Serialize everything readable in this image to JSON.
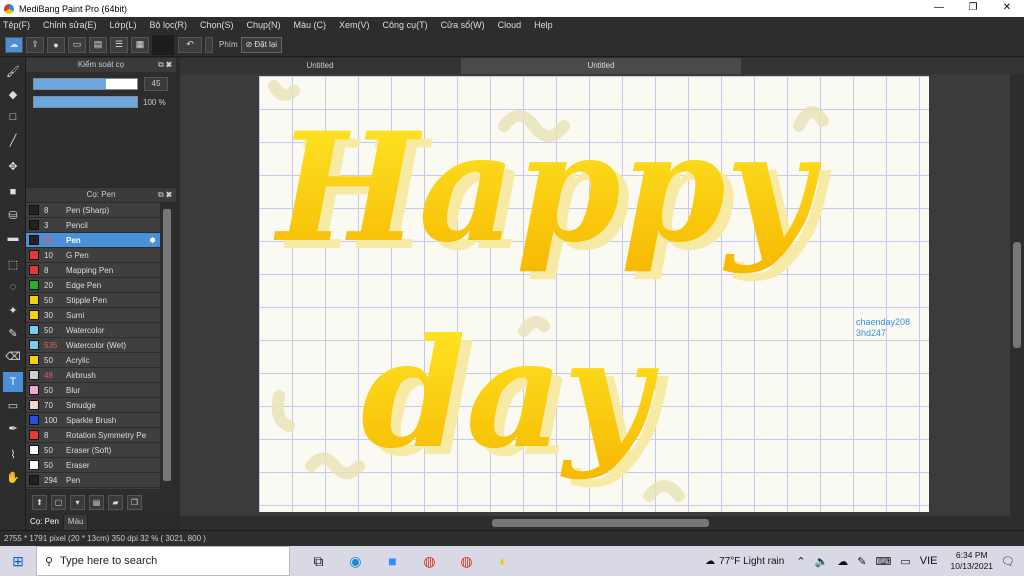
{
  "window": {
    "title": "MediBang Paint Pro (64bit)",
    "minimize_icon": "minimize-icon",
    "maximize_icon": "restore-icon",
    "close_icon": "close-icon"
  },
  "menu": [
    "Tệp(F)",
    "Chỉnh sửa(E)",
    "Lớp(L)",
    "Bộ lọc(R)",
    "Chọn(S)",
    "Chụp(N)",
    "Màu (C)",
    "Xem(V)",
    "Công cụ(T)",
    "Cửa sổ(W)",
    "Cloud",
    "Help"
  ],
  "toolbar": {
    "key_label": "Phím",
    "reset_label": "Đặt lại"
  },
  "brush_control": {
    "title": "Kiểm soát cọ",
    "size_value": "45",
    "size_fill": 0.7,
    "opacity_value": "100 %",
    "opacity_fill": 1.0
  },
  "brush_panel": {
    "title": "Cọ: Pen",
    "items": [
      {
        "size": "8",
        "name": "Pen (Sharp)",
        "color": "#222222",
        "red": false,
        "selected": false
      },
      {
        "size": "3",
        "name": "Pencil",
        "color": "#222222",
        "red": false,
        "selected": false
      },
      {
        "size": "45",
        "name": "Pen",
        "color": "#222222",
        "red": true,
        "selected": true
      },
      {
        "size": "10",
        "name": "G Pen",
        "color": "#e53935",
        "red": false,
        "selected": false
      },
      {
        "size": "8",
        "name": "Mapping Pen",
        "color": "#e53935",
        "red": false,
        "selected": false
      },
      {
        "size": "20",
        "name": "Edge Pen",
        "color": "#2fa82f",
        "red": false,
        "selected": false
      },
      {
        "size": "50",
        "name": "Stipple Pen",
        "color": "#f5d400",
        "red": false,
        "selected": false
      },
      {
        "size": "30",
        "name": "Sumi",
        "color": "#f5d400",
        "red": false,
        "selected": false
      },
      {
        "size": "50",
        "name": "Watercolor",
        "color": "#7ecbf0",
        "red": false,
        "selected": false
      },
      {
        "size": "535",
        "name": "Watercolor (Wet)",
        "color": "#7ecbf0",
        "red": true,
        "selected": false
      },
      {
        "size": "50",
        "name": "Acrylic",
        "color": "#f5d400",
        "red": false,
        "selected": false
      },
      {
        "size": "48",
        "name": "Airbrush",
        "color": "#cfcfcf",
        "red": true,
        "selected": false
      },
      {
        "size": "50",
        "name": "Blur",
        "color": "#f4a6d8",
        "red": false,
        "selected": false
      },
      {
        "size": "70",
        "name": "Smudge",
        "color": "#f2d9c8",
        "red": false,
        "selected": false
      },
      {
        "size": "100",
        "name": "Sparkle Brush",
        "color": "#2a4fd6",
        "red": false,
        "selected": false
      },
      {
        "size": "8",
        "name": "Rotation Symmetry Pe",
        "color": "#e53935",
        "red": false,
        "selected": false
      },
      {
        "size": "50",
        "name": "Eraser (Soft)",
        "color": "#ffffff",
        "red": false,
        "selected": false
      },
      {
        "size": "50",
        "name": "Eraser",
        "color": "#ffffff",
        "red": false,
        "selected": false
      },
      {
        "size": "294",
        "name": "Pen",
        "color": "#222222",
        "red": false,
        "selected": false
      }
    ]
  },
  "panel_tabs": [
    "Cọ: Pen",
    "Màu"
  ],
  "document_tabs": [
    "Untitled",
    "Untitled"
  ],
  "canvas": {
    "watermark_line1": "chaenday208",
    "watermark_line2": "3hd247"
  },
  "status": "2755 * 1791 pixel  (20 * 13cm)  350 dpi  32 %  ( 3021, 800 )",
  "taskbar": {
    "search_placeholder": "Type here to search",
    "weather": "77°F  Light rain",
    "lang": "VIE",
    "time": "6:34 PM",
    "date": "10/13/2021"
  }
}
